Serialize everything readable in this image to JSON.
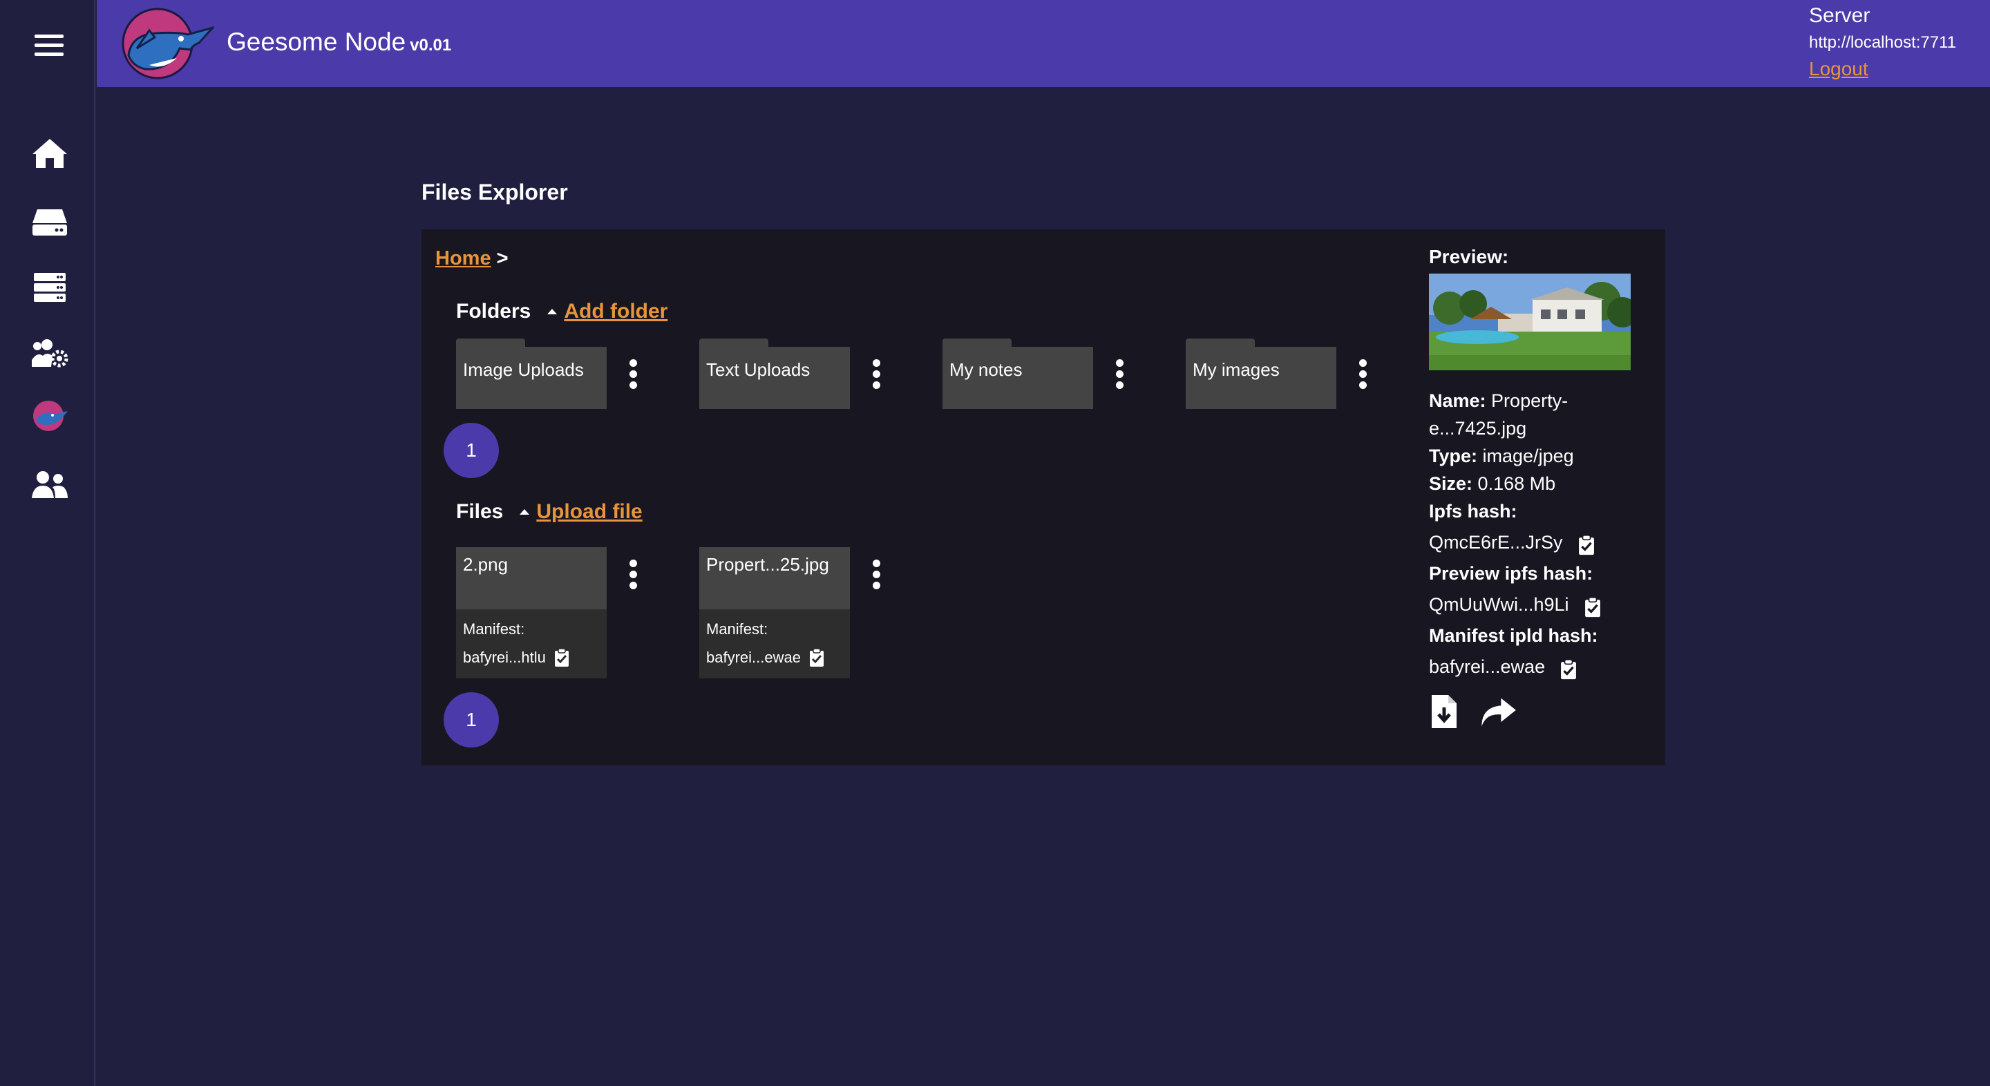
{
  "app": {
    "title": "Geesome Node",
    "version": "v0.01"
  },
  "server": {
    "label": "Server",
    "url": "http://localhost:7711",
    "logout": "Logout"
  },
  "sidebar": {
    "items": [
      {
        "icon": "home-icon"
      },
      {
        "icon": "storage-drive-icon"
      },
      {
        "icon": "server-icon"
      },
      {
        "icon": "users-cog-icon"
      },
      {
        "icon": "geesome-logo-icon"
      },
      {
        "icon": "users-icon"
      }
    ]
  },
  "page": {
    "title": "Files Explorer"
  },
  "breadcrumb": {
    "home": "Home",
    "separator": ">"
  },
  "folders": {
    "heading": "Folders",
    "add_label": "Add folder",
    "items": [
      {
        "name": "Image Uploads"
      },
      {
        "name": "Text Uploads"
      },
      {
        "name": "My notes"
      },
      {
        "name": "My images"
      }
    ],
    "page": "1"
  },
  "files": {
    "heading": "Files",
    "upload_label": "Upload file",
    "items": [
      {
        "name": "2.png",
        "manifest_label": "Manifest:",
        "manifest": "bafyrei...htlu"
      },
      {
        "name": "Propert...25.jpg",
        "manifest_label": "Manifest:",
        "manifest": "bafyrei...ewae"
      }
    ],
    "page": "1"
  },
  "preview": {
    "title": "Preview:",
    "name_label": "Name:",
    "name_value_1": "Property-",
    "name_value_2": "e...7425.jpg",
    "type_label": "Type:",
    "type_value": "image/jpeg",
    "size_label": "Size:",
    "size_value": "0.168 Mb",
    "ipfs_label": "Ipfs hash:",
    "ipfs_value": "QmcE6rE...JrSy",
    "preview_ipfs_label": "Preview ipfs hash:",
    "preview_ipfs_value": "QmUuWwi...h9Li",
    "manifest_label": "Manifest ipld hash:",
    "manifest_value": "bafyrei...ewae"
  },
  "colors": {
    "background": "#211f40",
    "header": "#4b3aa9",
    "panel": "#171621",
    "accent": "#e7953c",
    "card": "#444444"
  }
}
